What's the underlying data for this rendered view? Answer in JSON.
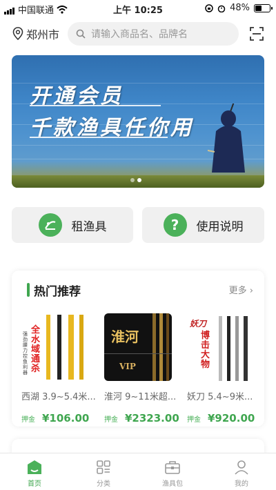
{
  "status_bar": {
    "carrier": "中国联通",
    "time": "上午 10:25",
    "battery": "48%",
    "battery_level": 0.48
  },
  "header": {
    "city": "郑州市",
    "search_placeholder": "请输入商品名、品牌名"
  },
  "banner": {
    "title": "开通会员",
    "subtitle": "千款渔具任你用",
    "slide_count": 2,
    "active_slide": 1
  },
  "quick_actions": [
    {
      "label": "租渔具",
      "icon": "fishing-icon"
    },
    {
      "label": "使用说明",
      "icon": "help-icon"
    }
  ],
  "hot": {
    "title": "热门推荐",
    "more": "更多",
    "products": [
      {
        "name": "西湖 3.9~5.4米...",
        "deposit_label": "押金",
        "price": "¥106.00",
        "promo_text": "全水域通杀",
        "promo_sub": "强劲腰力 控鱼利器"
      },
      {
        "name": "淮河 9~11米超...",
        "deposit_label": "押金",
        "price": "¥2323.00",
        "promo_text": "淮河",
        "promo_sub": "VIP"
      },
      {
        "name": "妖刀 5.4~9米...",
        "deposit_label": "押金",
        "price": "¥920.00",
        "promo_text": "博击大物",
        "promo_sub": "妖刀"
      }
    ]
  },
  "tabs": [
    {
      "label": "首页",
      "icon": "home-icon",
      "active": true
    },
    {
      "label": "分类",
      "icon": "category-icon",
      "active": false
    },
    {
      "label": "渔具包",
      "icon": "tackle-bag-icon",
      "active": false
    },
    {
      "label": "我的",
      "icon": "profile-icon",
      "active": false
    }
  ],
  "colors": {
    "brand_green": "#3fa64f",
    "quick_bg": "#f0f0f0"
  }
}
